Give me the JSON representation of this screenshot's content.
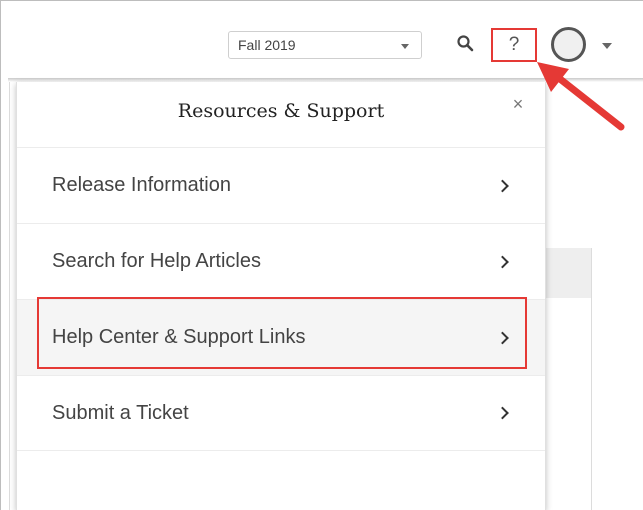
{
  "header": {
    "term_select": {
      "value": "Fall 2019"
    },
    "help_label": "?"
  },
  "panel": {
    "title": "Resources & Support",
    "close_label": "×",
    "items": [
      {
        "label": "Release Information"
      },
      {
        "label": "Search for Help Articles"
      },
      {
        "label": "Help Center & Support Links"
      },
      {
        "label": "Submit a Ticket"
      }
    ]
  },
  "colors": {
    "annotation_red": "#e53935",
    "text": "#444444"
  }
}
